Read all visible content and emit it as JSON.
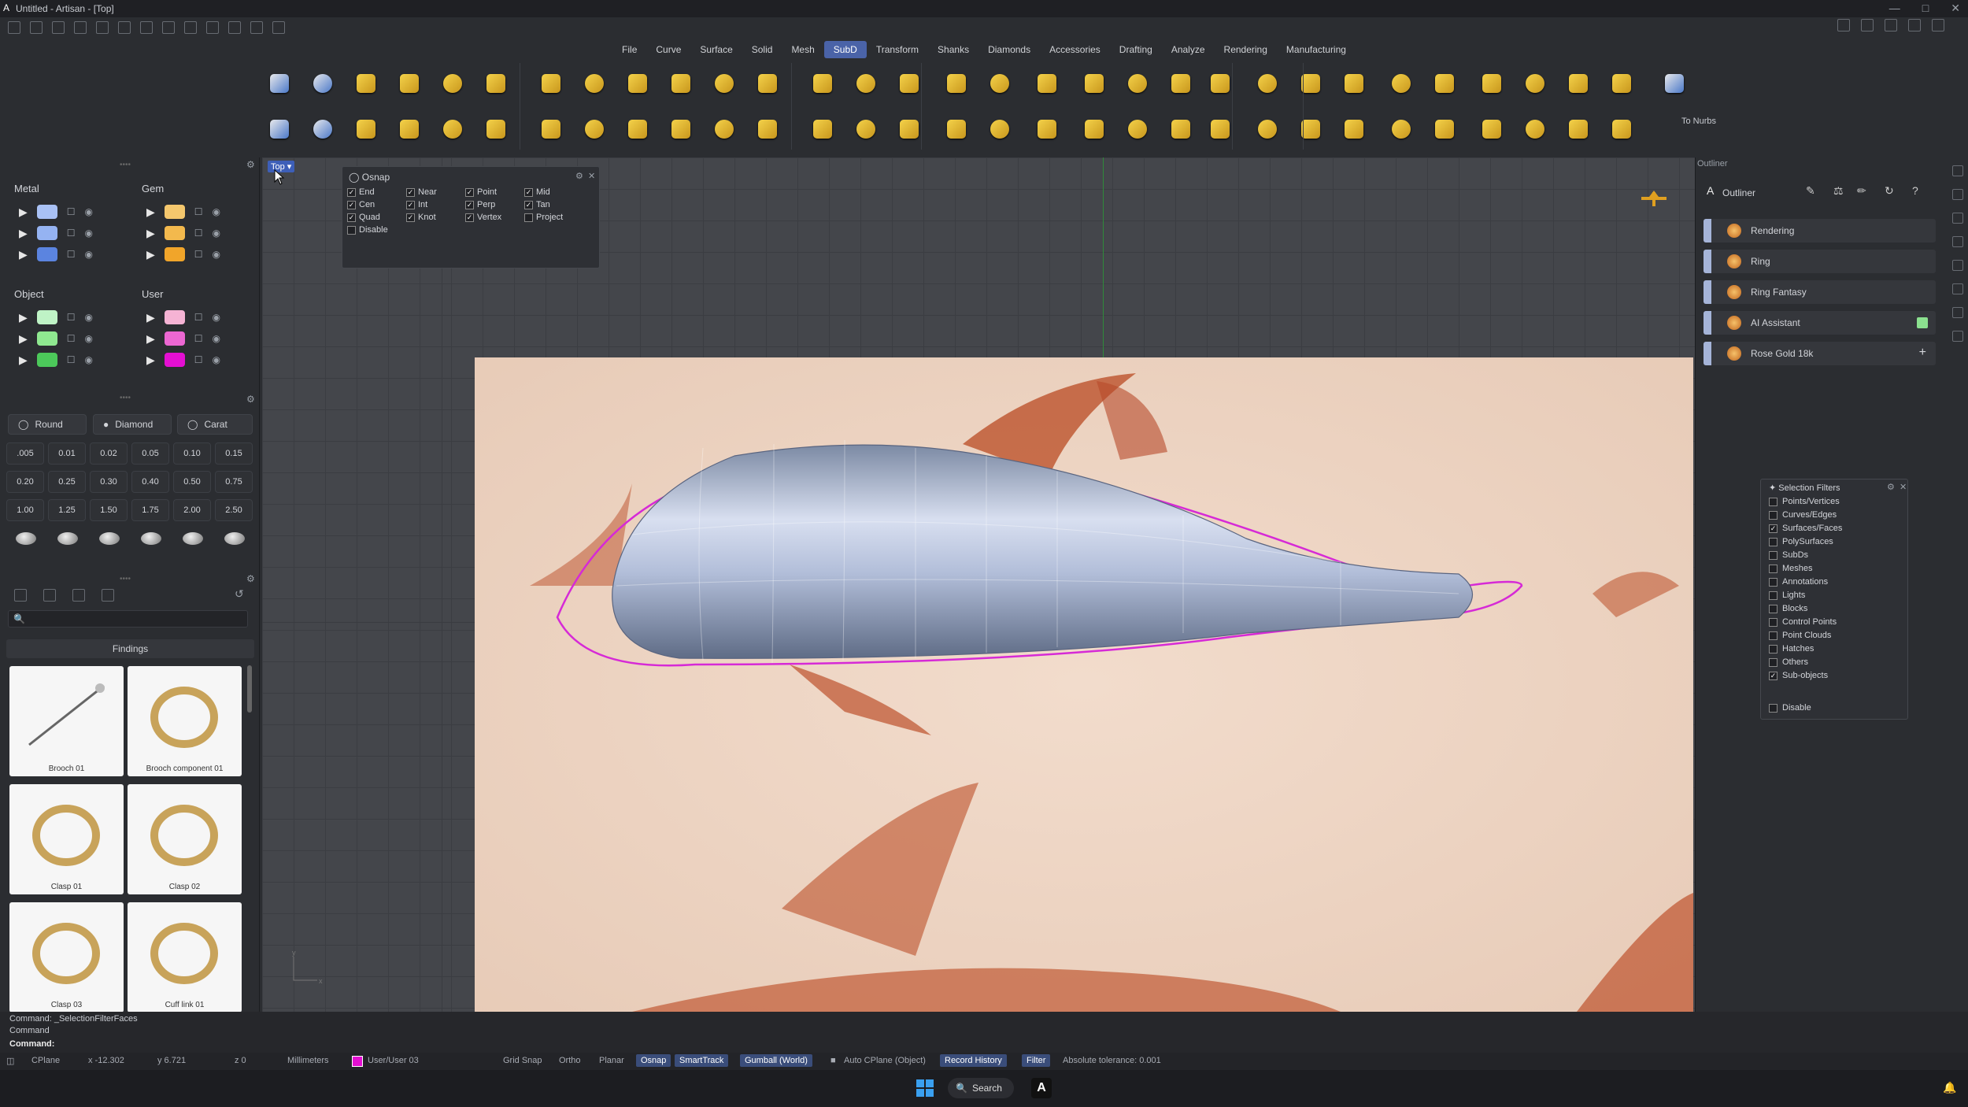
{
  "window": {
    "title": "Untitled - Artisan - [Top]"
  },
  "menu": [
    "File",
    "Curve",
    "Surface",
    "Solid",
    "Mesh",
    "SubD",
    "Transform",
    "Shanks",
    "Diamonds",
    "Accessories",
    "Drafting",
    "Analyze",
    "Rendering",
    "Manufacturing"
  ],
  "menu_active": "SubD",
  "ribbon": {
    "to_nurbs_label": "To Nurbs"
  },
  "layers": {
    "metal": {
      "label": "Metal",
      "colors": [
        "#a9c1f5",
        "#95b3f2",
        "#5b84e0"
      ]
    },
    "gem": {
      "label": "Gem",
      "colors": [
        "#f4c76d",
        "#f3b94d",
        "#f1a52a"
      ]
    },
    "object": {
      "label": "Object",
      "colors": [
        "#bff3c6",
        "#8fe890",
        "#4cc85a"
      ]
    },
    "user": {
      "label": "User",
      "colors": [
        "#f5b3d4",
        "#ec67d2",
        "#e40fd2"
      ]
    }
  },
  "gem_tools": {
    "round": "Round",
    "diamond": "Diamond",
    "carat": "Carat",
    "sizes": [
      ".005",
      "0.01",
      "0.02",
      "0.05",
      "0.10",
      "0.15",
      "0.20",
      "0.25",
      "0.30",
      "0.40",
      "0.50",
      "0.75",
      "1.00",
      "1.25",
      "1.50",
      "1.75",
      "2.00",
      "2.50"
    ]
  },
  "findings": {
    "header": "Findings",
    "items": [
      "Brooch 01",
      "Brooch component 01",
      "Clasp 01",
      "Clasp 02",
      "Clasp 03",
      "Cuff link 01"
    ]
  },
  "viewport": {
    "label": "Top"
  },
  "osnap": {
    "title": "Osnap",
    "options": [
      {
        "label": "End",
        "checked": true
      },
      {
        "label": "Near",
        "checked": true
      },
      {
        "label": "Point",
        "checked": true
      },
      {
        "label": "Mid",
        "checked": true
      },
      {
        "label": "Cen",
        "checked": true
      },
      {
        "label": "Int",
        "checked": true
      },
      {
        "label": "Perp",
        "checked": true
      },
      {
        "label": "Tan",
        "checked": true
      },
      {
        "label": "Quad",
        "checked": true
      },
      {
        "label": "Knot",
        "checked": true
      },
      {
        "label": "Vertex",
        "checked": true
      },
      {
        "label": "Project",
        "checked": false
      },
      {
        "label": "Disable",
        "checked": false
      }
    ]
  },
  "outliner": {
    "panel_title": "Outliner",
    "tab": "Outliner",
    "items": [
      "Rendering",
      "Ring",
      "Ring Fantasy",
      "AI Assistant",
      "Rose Gold 18k"
    ]
  },
  "selection_filters": {
    "title": "Selection Filters",
    "items": [
      {
        "label": "Points/Vertices",
        "checked": false
      },
      {
        "label": "Curves/Edges",
        "checked": false
      },
      {
        "label": "Surfaces/Faces",
        "checked": true
      },
      {
        "label": "PolySurfaces",
        "checked": false
      },
      {
        "label": "SubDs",
        "checked": false
      },
      {
        "label": "Meshes",
        "checked": false
      },
      {
        "label": "Annotations",
        "checked": false
      },
      {
        "label": "Lights",
        "checked": false
      },
      {
        "label": "Blocks",
        "checked": false
      },
      {
        "label": "Control Points",
        "checked": false
      },
      {
        "label": "Point Clouds",
        "checked": false
      },
      {
        "label": "Hatches",
        "checked": false
      },
      {
        "label": "Others",
        "checked": false
      },
      {
        "label": "Sub-objects",
        "checked": true
      }
    ],
    "disable": "Disable"
  },
  "command": {
    "history1": "Command: _SelectionFilterFaces",
    "history2": "Command",
    "prompt": "Command:"
  },
  "status": {
    "cplane": "CPlane",
    "x": "x -12.302",
    "y": "y 6.721",
    "z": "z 0",
    "units": "Millimeters",
    "layer": "User/User 03",
    "grid_snap": "Grid Snap",
    "ortho": "Ortho",
    "planar": "Planar",
    "osnap": "Osnap",
    "smarttrack": "SmartTrack",
    "gumball": "Gumball (World)",
    "auto_cplane": "Auto CPlane (Object)",
    "record_history": "Record History",
    "filter": "Filter",
    "tolerance": "Absolute tolerance: 0.001"
  },
  "taskbar": {
    "search": "Search"
  }
}
